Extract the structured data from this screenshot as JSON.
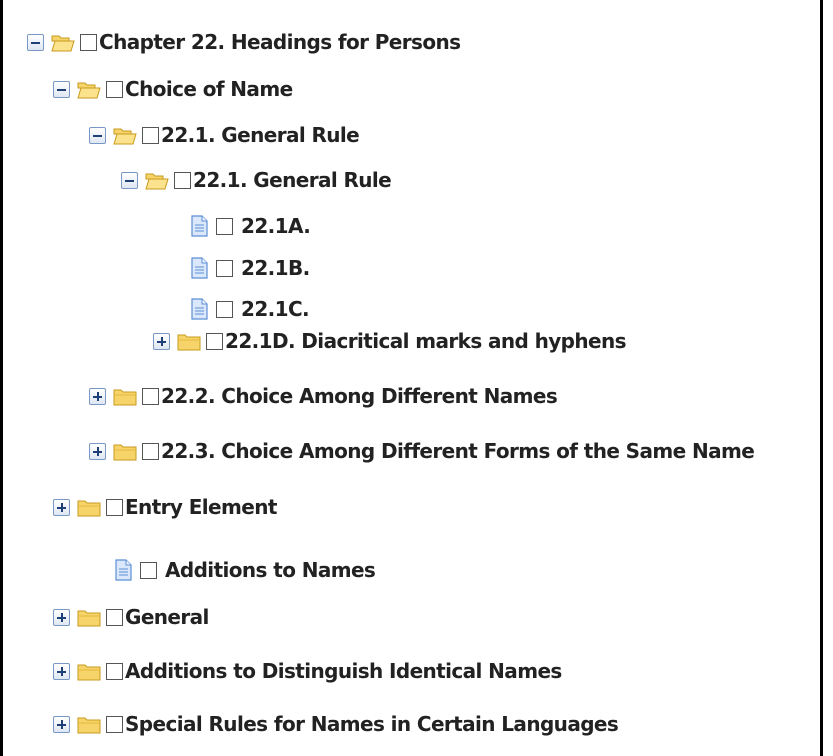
{
  "tree": {
    "nodes": [
      {
        "label": "Chapter 22. Headings for Persons",
        "type": "folder",
        "state": "expanded",
        "checked": false
      },
      {
        "label": "Choice of Name",
        "type": "folder",
        "state": "expanded",
        "checked": false
      },
      {
        "label": "22.1. General Rule",
        "type": "folder",
        "state": "expanded",
        "checked": false
      },
      {
        "label": "22.1. General Rule",
        "type": "folder",
        "state": "expanded",
        "checked": false
      },
      {
        "label": "22.1A.",
        "type": "document",
        "checked": false
      },
      {
        "label": "22.1B.",
        "type": "document",
        "checked": false
      },
      {
        "label": "22.1C.",
        "type": "document",
        "checked": false
      },
      {
        "label": "22.1D. Diacritical marks and hyphens",
        "type": "folder",
        "state": "collapsed",
        "checked": false
      },
      {
        "label": "22.2. Choice Among Different Names",
        "type": "folder",
        "state": "collapsed",
        "checked": false
      },
      {
        "label": "22.3. Choice Among Different Forms of the Same Name",
        "type": "folder",
        "state": "collapsed",
        "checked": false
      },
      {
        "label": "Entry Element",
        "type": "folder",
        "state": "collapsed",
        "checked": false
      },
      {
        "label": "Additions to Names",
        "type": "document",
        "checked": false
      },
      {
        "label": "General",
        "type": "folder",
        "state": "collapsed",
        "checked": false
      },
      {
        "label": "Additions to Distinguish Identical Names",
        "type": "folder",
        "state": "collapsed",
        "checked": false
      },
      {
        "label": "Special Rules for Names in Certain Languages",
        "type": "folder",
        "state": "collapsed",
        "checked": false
      }
    ]
  },
  "colors": {
    "folder_fill": "#f6d46a",
    "folder_stroke": "#c89a1c",
    "doc_fill": "#dbe8fb",
    "doc_stroke": "#5b8fd6",
    "toggle_border": "#7a98c4"
  },
  "icons": {
    "expanded": "minus-toggle-icon",
    "collapsed": "plus-toggle-icon",
    "open_folder": "open-folder-icon",
    "folder": "folder-icon",
    "document": "document-icon",
    "checkbox": "checkbox-icon"
  }
}
